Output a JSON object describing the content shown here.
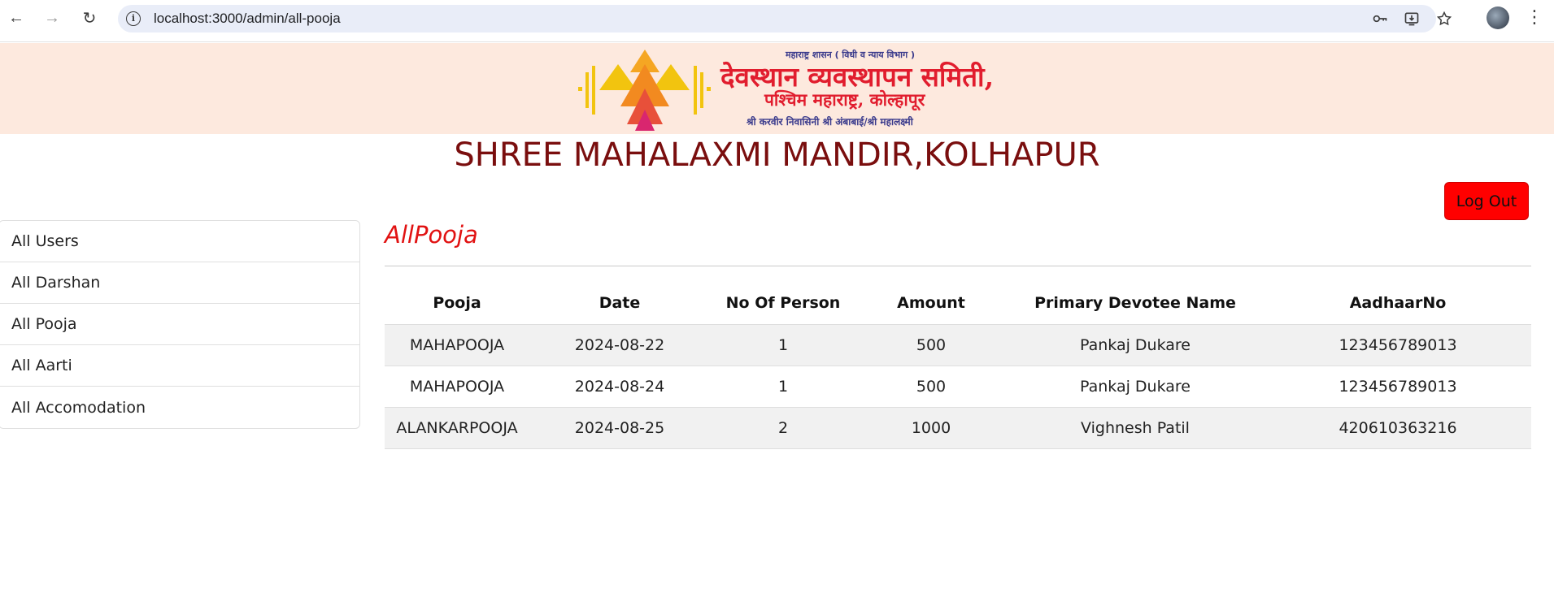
{
  "browser": {
    "url": "localhost:3000/admin/all-pooja"
  },
  "banner": {
    "top_line": "महाराष्ट्र शासन ( विधी व न्याय विभाग )",
    "title": "देवस्थान व्यवस्थापन समिती,",
    "line2": "पश्चिम महाराष्ट्र, कोल्हापूर",
    "line3": "श्री करवीर निवासिनी श्री अंबाबाई/श्री महालक्ष्मी"
  },
  "page": {
    "title": "SHREE MAHALAXMI MANDIR,KOLHAPUR",
    "logout_label": "Log Out",
    "section_title": "AllPooja"
  },
  "sidebar": {
    "items": [
      {
        "label": "All Users"
      },
      {
        "label": "All Darshan"
      },
      {
        "label": "All Pooja"
      },
      {
        "label": "All Aarti"
      },
      {
        "label": "All Accomodation"
      }
    ]
  },
  "table": {
    "headers": [
      "Pooja",
      "Date",
      "No Of Person",
      "Amount",
      "Primary Devotee Name",
      "AadhaarNo"
    ],
    "rows": [
      [
        "MAHAPOOJA",
        "2024-08-22",
        "1",
        "500",
        "Pankaj Dukare",
        "123456789013"
      ],
      [
        "MAHAPOOJA",
        "2024-08-24",
        "1",
        "500",
        "Pankaj Dukare",
        "123456789013"
      ],
      [
        "ALANKARPOOJA",
        "2024-08-25",
        "2",
        "1000",
        "Vighnesh Patil",
        "420610363216"
      ]
    ]
  },
  "colors": {
    "accent_red": "#ff0000",
    "title_maroon": "#7a0e0e",
    "banner_bg": "#fde9de"
  }
}
